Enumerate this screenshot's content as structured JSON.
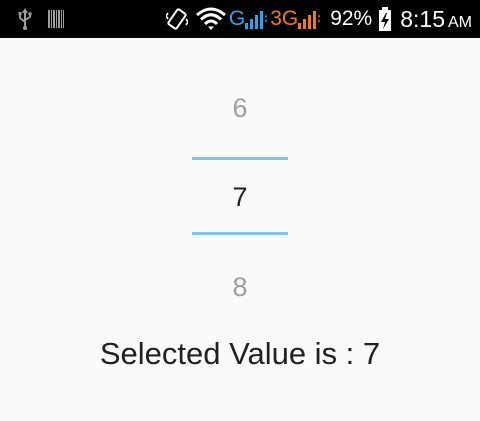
{
  "status_bar": {
    "left_icons": [
      "usb-icon",
      "barcode-icon"
    ],
    "right_icons": [
      "vibrate-icon",
      "wifi-icon",
      "signal-icon"
    ],
    "network_1": "G",
    "network_2": "3G",
    "battery_percent": "92%",
    "time": "8:15",
    "ampm": "AM",
    "colors": {
      "background": "#000000",
      "network_g": "#2aa6ea",
      "network_3g": "#f07a1a"
    }
  },
  "number_picker": {
    "previous_value": "6",
    "selected_value": "7",
    "next_value": "8",
    "divider_color": "#7ec6e6"
  },
  "result": {
    "text": "Selected Value is : 7"
  }
}
